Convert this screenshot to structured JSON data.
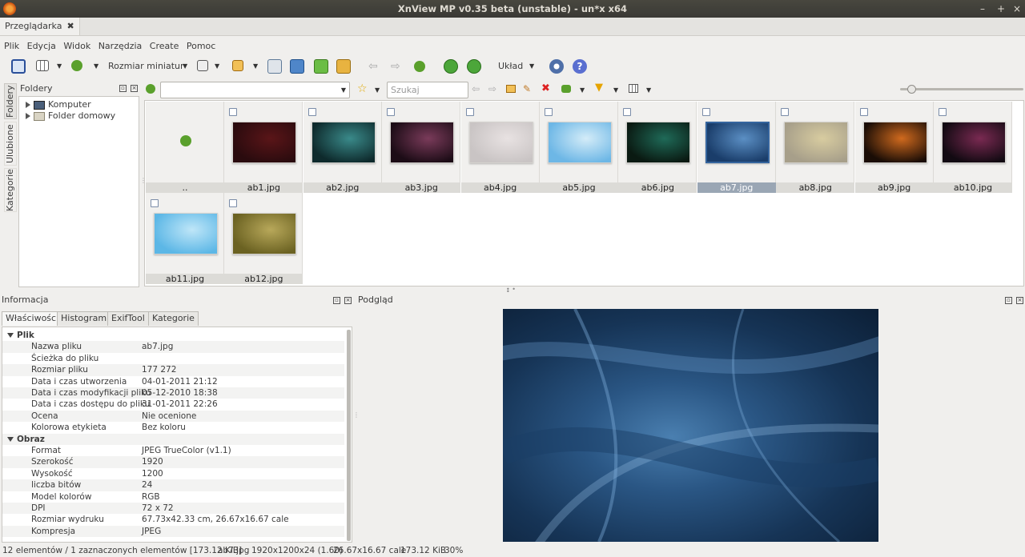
{
  "window": {
    "title": "XnView MP v0.35 beta (unstable) - un*x x64"
  },
  "tabs": [
    {
      "label": "Przeglądarka"
    }
  ],
  "menu": [
    "Plik",
    "Edycja",
    "Widok",
    "Narzędzia",
    "Create",
    "Pomoc"
  ],
  "toolbar": {
    "thumb_size_label": "Rozmiar miniatur",
    "layout_label": "Układ"
  },
  "search": {
    "placeholder": "Szukaj"
  },
  "side_tabs": [
    "Foldery",
    "Ulubione",
    "Kategorie"
  ],
  "folders": {
    "title": "Foldery",
    "items": [
      "Komputer",
      "Folder domowy"
    ]
  },
  "browser": {
    "up_label": "..",
    "files": [
      "ab1.jpg",
      "ab2.jpg",
      "ab3.jpg",
      "ab4.jpg",
      "ab5.jpg",
      "ab6.jpg",
      "ab7.jpg",
      "ab8.jpg",
      "ab9.jpg",
      "ab10.jpg",
      "ab11.jpg",
      "ab12.jpg"
    ],
    "selected": "ab7.jpg",
    "thumb_colors": [
      [
        "#2a0b0e",
        "#5a1518"
      ],
      [
        "#0e2a2c",
        "#3a8a8a"
      ],
      [
        "#1c0c16",
        "#7a3b5a"
      ],
      [
        "#c9c4c4",
        "#e8e2e2"
      ],
      [
        "#6db7e6",
        "#d4ecf8"
      ],
      [
        "#0a1a12",
        "#1f6a58"
      ],
      [
        "#1a3d6a",
        "#5b8fc4"
      ],
      [
        "#a79f8a",
        "#d8cca0"
      ],
      [
        "#1a0d06",
        "#d06a1e"
      ],
      [
        "#120a12",
        "#7a2a52"
      ],
      [
        "#5cb7e6",
        "#bfe6f8"
      ],
      [
        "#6b6222",
        "#b8a85a"
      ]
    ]
  },
  "info": {
    "title": "Informacja",
    "tabs": [
      "Właściwości",
      "Histogram",
      "ExifTool",
      "Kategorie"
    ],
    "rows": [
      {
        "group": true,
        "k": "Plik",
        "v": ""
      },
      {
        "k": "Nazwa pliku",
        "v": "ab7.jpg"
      },
      {
        "k": "Ścieżka do pliku",
        "v": ""
      },
      {
        "k": "Rozmiar pliku",
        "v": "177 272"
      },
      {
        "k": "Data i czas utworzenia",
        "v": "04-01-2011 21:12"
      },
      {
        "k": "Data i czas modyfikacji pliku",
        "v": "05-12-2010 18:38"
      },
      {
        "k": "Data i czas dostępu do pliku",
        "v": "31-01-2011 22:26"
      },
      {
        "k": "Ocena",
        "v": "Nie ocenione"
      },
      {
        "k": "Kolorowa etykieta",
        "v": "Bez koloru"
      },
      {
        "group": true,
        "k": "Obraz",
        "v": ""
      },
      {
        "k": "Format",
        "v": "JPEG TrueColor (v1.1)"
      },
      {
        "k": "Szerokość",
        "v": "1920"
      },
      {
        "k": "Wysokość",
        "v": "1200"
      },
      {
        "k": "liczba bitów",
        "v": "24"
      },
      {
        "k": "Model kolorów",
        "v": "RGB"
      },
      {
        "k": "DPI",
        "v": "72 x 72"
      },
      {
        "k": "Rozmiar wydruku",
        "v": "67.73x42.33 cm, 26.67x16.67 cale"
      },
      {
        "k": "Kompresja",
        "v": "JPEG"
      }
    ]
  },
  "preview": {
    "title": "Podgląd"
  },
  "status": [
    "12 elementów / 1 zaznaczonych elementów [173.12 KiB]",
    "ab7.jpg",
    "1920x1200x24 (1.60)",
    "26.67x16.67 cale",
    "173.12 KiB",
    "30%"
  ]
}
